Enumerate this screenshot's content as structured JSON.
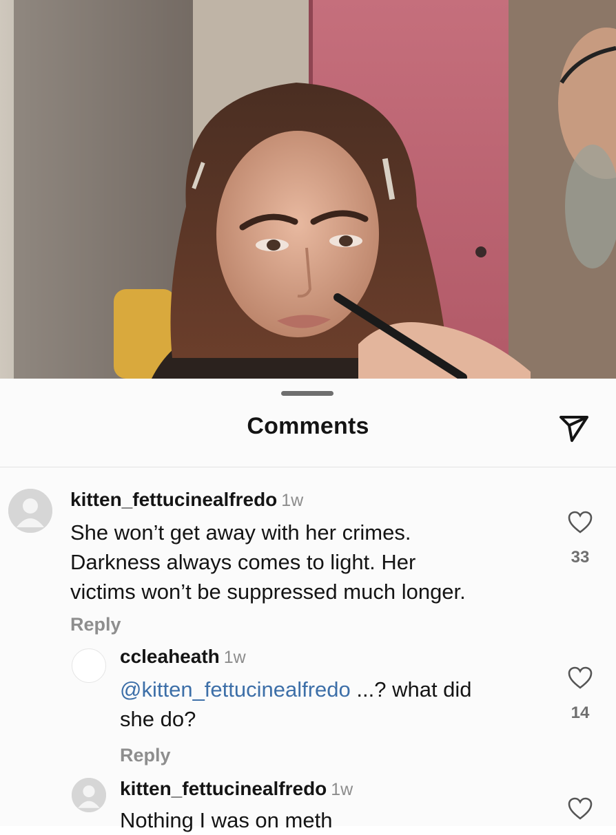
{
  "photo": {
    "icon": "portrait-photo"
  },
  "sheet": {
    "title": "Comments",
    "share_icon": "send-icon"
  },
  "comments": [
    {
      "username": "kitten_fettucinealfredo",
      "time": "1w",
      "lines": [
        "She won’t get away with her crimes.",
        "Darkness always comes to light. Her",
        "victims won’t be suppressed much longer."
      ],
      "reply_label": "Reply",
      "likes": "33"
    },
    {
      "username": "ccleaheath",
      "time": "1w",
      "mention": "@kitten_fettucinealfredo",
      "text_after_mention": " ...? what did",
      "line2": "she do?",
      "reply_label": "Reply",
      "likes": "14"
    },
    {
      "username": "kitten_fettucinealfredo",
      "time": "1w",
      "text": "Nothing I was on meth"
    }
  ],
  "colors": {
    "mention": "#3d6fa8",
    "muted": "#8e8e8e",
    "door": "#b8616f"
  }
}
